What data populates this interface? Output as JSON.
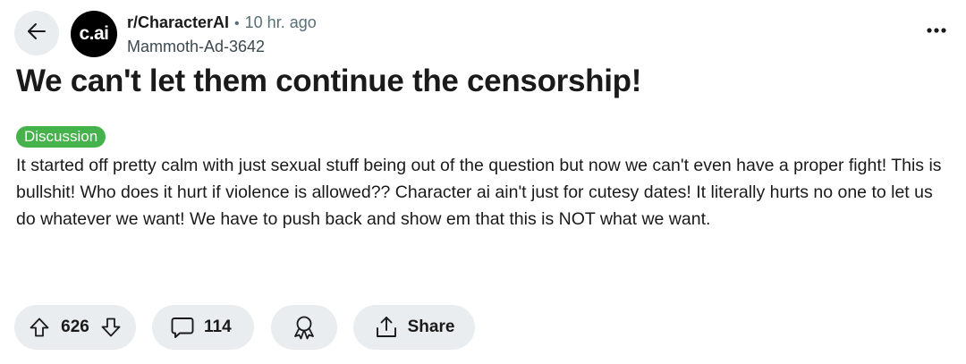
{
  "header": {
    "avatar_text": "c.ai",
    "subreddit": "r/CharacterAI",
    "separator": "•",
    "time_ago": "10 hr. ago",
    "username": "Mammoth-Ad-3642"
  },
  "post": {
    "title": "We can't let them continue the censorship!",
    "flair": "Discussion",
    "flair_color": "#46b24b",
    "body": "It started off pretty calm with just sexual stuff being out of the question but now we can't even have a proper fight! This is bullshit! Who does it hurt if violence is allowed?? Character ai ain't just for cutesy dates! It literally hurts no one to let us do whatever we want! We have to push back and show em that this is NOT what we want."
  },
  "actions": {
    "vote_count": "626",
    "comment_count": "114",
    "share_label": "Share"
  },
  "icons": {
    "back": "arrow-left-icon",
    "more": "ellipsis-icon",
    "upvote": "upvote-arrow-icon",
    "downvote": "downvote-arrow-icon",
    "comment": "speech-bubble-icon",
    "award": "award-ribbon-icon",
    "share": "share-upload-icon"
  },
  "colors": {
    "pill_background": "#eaedef",
    "text": "#1a1a1b",
    "muted_text": "#576f76"
  }
}
